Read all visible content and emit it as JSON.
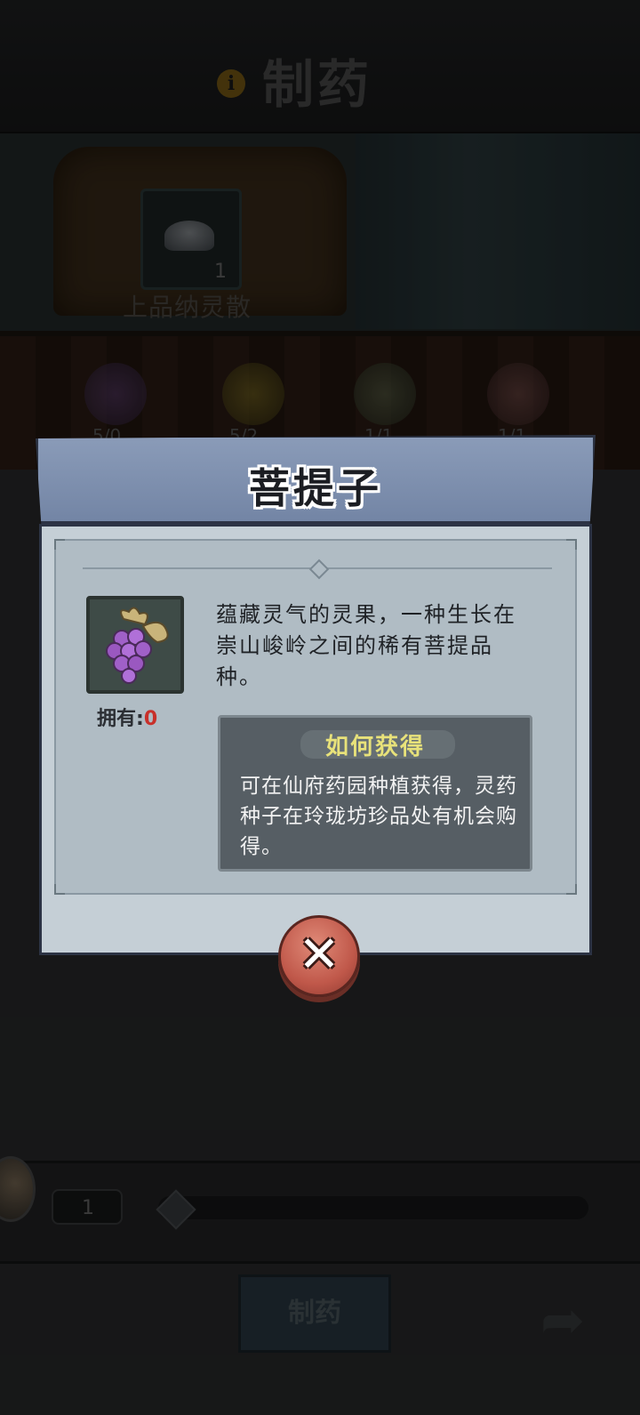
{
  "header": {
    "title": "制药",
    "info_icon": "i"
  },
  "scene": {
    "pill_name": "上品纳灵散",
    "pill_count": "1",
    "ingredients": [
      {
        "icon": "grape-icon",
        "count": "5/0"
      },
      {
        "icon": "flower-icon",
        "count": "5/2"
      },
      {
        "icon": "herb-icon",
        "count": "1/1"
      },
      {
        "icon": "mushroom-icon",
        "count": "1/1"
      }
    ]
  },
  "modal": {
    "title": "菩提子",
    "description": "蕴藏灵气的灵果，一种生长在崇山峻岭之间的稀有菩提品种。",
    "owned_label": "拥有:",
    "owned_value": "0",
    "obtain_title": "如何获得",
    "obtain_text": "可在仙府药园种植获得，灵药种子在玲珑坊珍品处有机会购得。",
    "close_icon": "close-icon"
  },
  "bottom": {
    "quantity": "1",
    "make_button": "制药"
  },
  "colors": {
    "modal_header": "#7f90ae",
    "modal_body": "#c5cfd6",
    "obtain_title": "#e8e27a",
    "owned_value": "#c8302a",
    "close_button": "#c0584a"
  }
}
